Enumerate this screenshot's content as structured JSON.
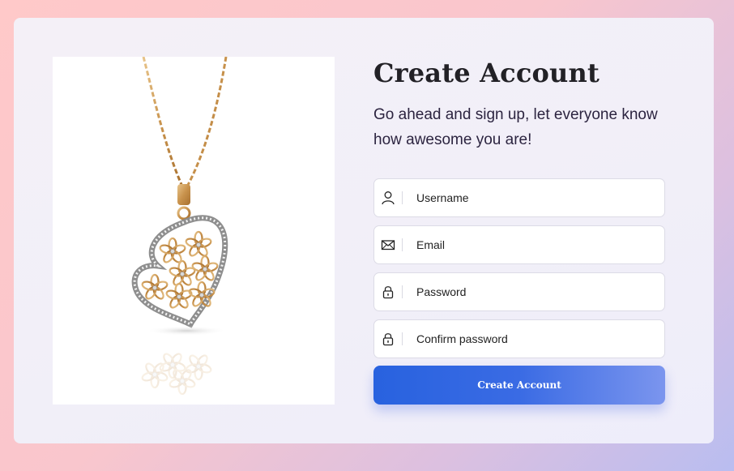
{
  "signup": {
    "title": "Create Account",
    "subtitle": "Go ahead and sign up, let everyone know how awesome you are!",
    "fields": [
      {
        "icon": "user-icon",
        "placeholder": "Username",
        "value": ""
      },
      {
        "icon": "envelope-icon",
        "placeholder": "Email",
        "value": ""
      },
      {
        "icon": "lock-icon",
        "placeholder": "Password",
        "value": ""
      },
      {
        "icon": "lock-icon",
        "placeholder": "Confirm password",
        "value": ""
      }
    ],
    "submit_label": "Create Account"
  },
  "image": {
    "subject": "gold heart pendant necklace"
  },
  "colors": {
    "accent_start": "#2862df",
    "accent_end": "#7b95ee",
    "title": "#222126",
    "subtitle": "#2c2440"
  }
}
